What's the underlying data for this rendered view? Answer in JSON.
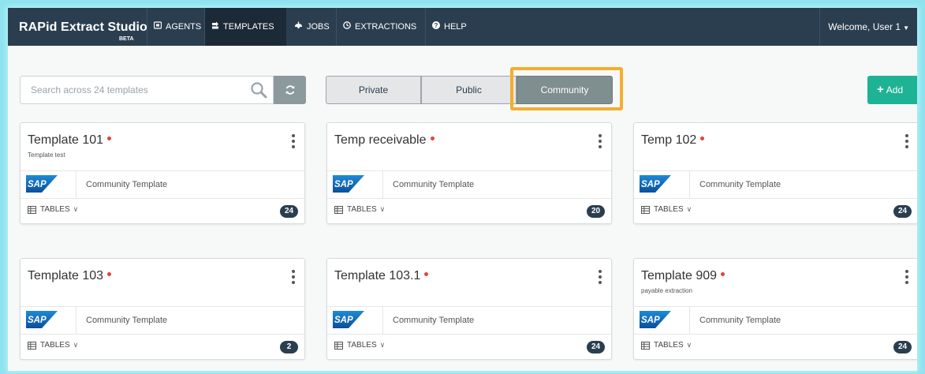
{
  "app": {
    "brand": "RAPid Extract Studio",
    "brand_badge": "BETA"
  },
  "nav": {
    "items": [
      {
        "label": "AGENTS",
        "icon": "agent-icon"
      },
      {
        "label": "TEMPLATES",
        "icon": "template-icon",
        "active": true
      },
      {
        "label": "JOBS",
        "icon": "jobs-icon"
      },
      {
        "label": "EXTRACTIONS",
        "icon": "clock-icon"
      },
      {
        "label": "HELP",
        "icon": "help-icon"
      }
    ],
    "welcome": "Welcome, User 1"
  },
  "toolbar": {
    "search_placeholder": "Search across 24 templates",
    "segments": [
      "Private",
      "Public",
      "Community"
    ],
    "selected_segment": "Community",
    "add_label": "Add"
  },
  "colors": {
    "nav_bg": "#2b3e50",
    "accent_green": "#1db394",
    "status_red": "#e8413a",
    "highlight": "#f3ae2e"
  },
  "cards": [
    {
      "title": "Template 101",
      "subtitle": "Template test",
      "logo": "SAP",
      "description": "Community Template",
      "tables_label": "TABLES",
      "count": "24"
    },
    {
      "title": "Temp receivable",
      "subtitle": "",
      "logo": "SAP",
      "description": "Community Template",
      "tables_label": "TABLES",
      "count": "20"
    },
    {
      "title": "Temp 102",
      "subtitle": "",
      "logo": "SAP",
      "description": "Community Template",
      "tables_label": "TABLES",
      "count": "24"
    },
    {
      "title": "Template 103",
      "subtitle": "",
      "logo": "SAP",
      "description": "Community Template",
      "tables_label": "TABLES",
      "count": "2"
    },
    {
      "title": "Template 103.1",
      "subtitle": "",
      "logo": "SAP",
      "description": "Community Template",
      "tables_label": "TABLES",
      "count": "24"
    },
    {
      "title": "Template 909",
      "subtitle": "payable extraction",
      "logo": "SAP",
      "description": "Community Template",
      "tables_label": "TABLES",
      "count": "24"
    }
  ]
}
